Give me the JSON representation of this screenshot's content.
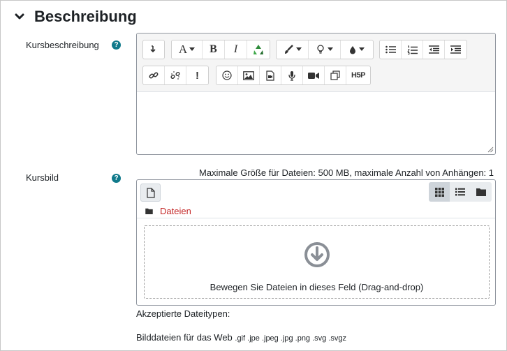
{
  "section": {
    "title": "Beschreibung"
  },
  "course_description": {
    "label": "Kursbeschreibung",
    "help": "?",
    "toolbar": {
      "font_button": "A",
      "bold": "B",
      "italic": "I",
      "accessibility": "!",
      "h5p": "H5P"
    },
    "content": ""
  },
  "course_image": {
    "label": "Kursbild",
    "help": "?",
    "limits": "Maximale Größe für Dateien: 500 MB, maximale Anzahl von Anhängen: 1",
    "path_label": "Dateien",
    "dropzone_text": "Bewegen Sie Dateien in dieses Feld (Drag-and-drop)",
    "accepted_label": "Akzeptierte Dateitypen:",
    "accepted_type_name": "Bilddateien für das Web",
    "accepted_extensions": ".gif .jpe .jpeg .jpg .png .svg .svgz"
  },
  "colors": {
    "help_icon": "#117a8b",
    "path_link": "#c42828",
    "toolbar_bg": "#f5f5f5",
    "active_view": "#ced4da"
  }
}
